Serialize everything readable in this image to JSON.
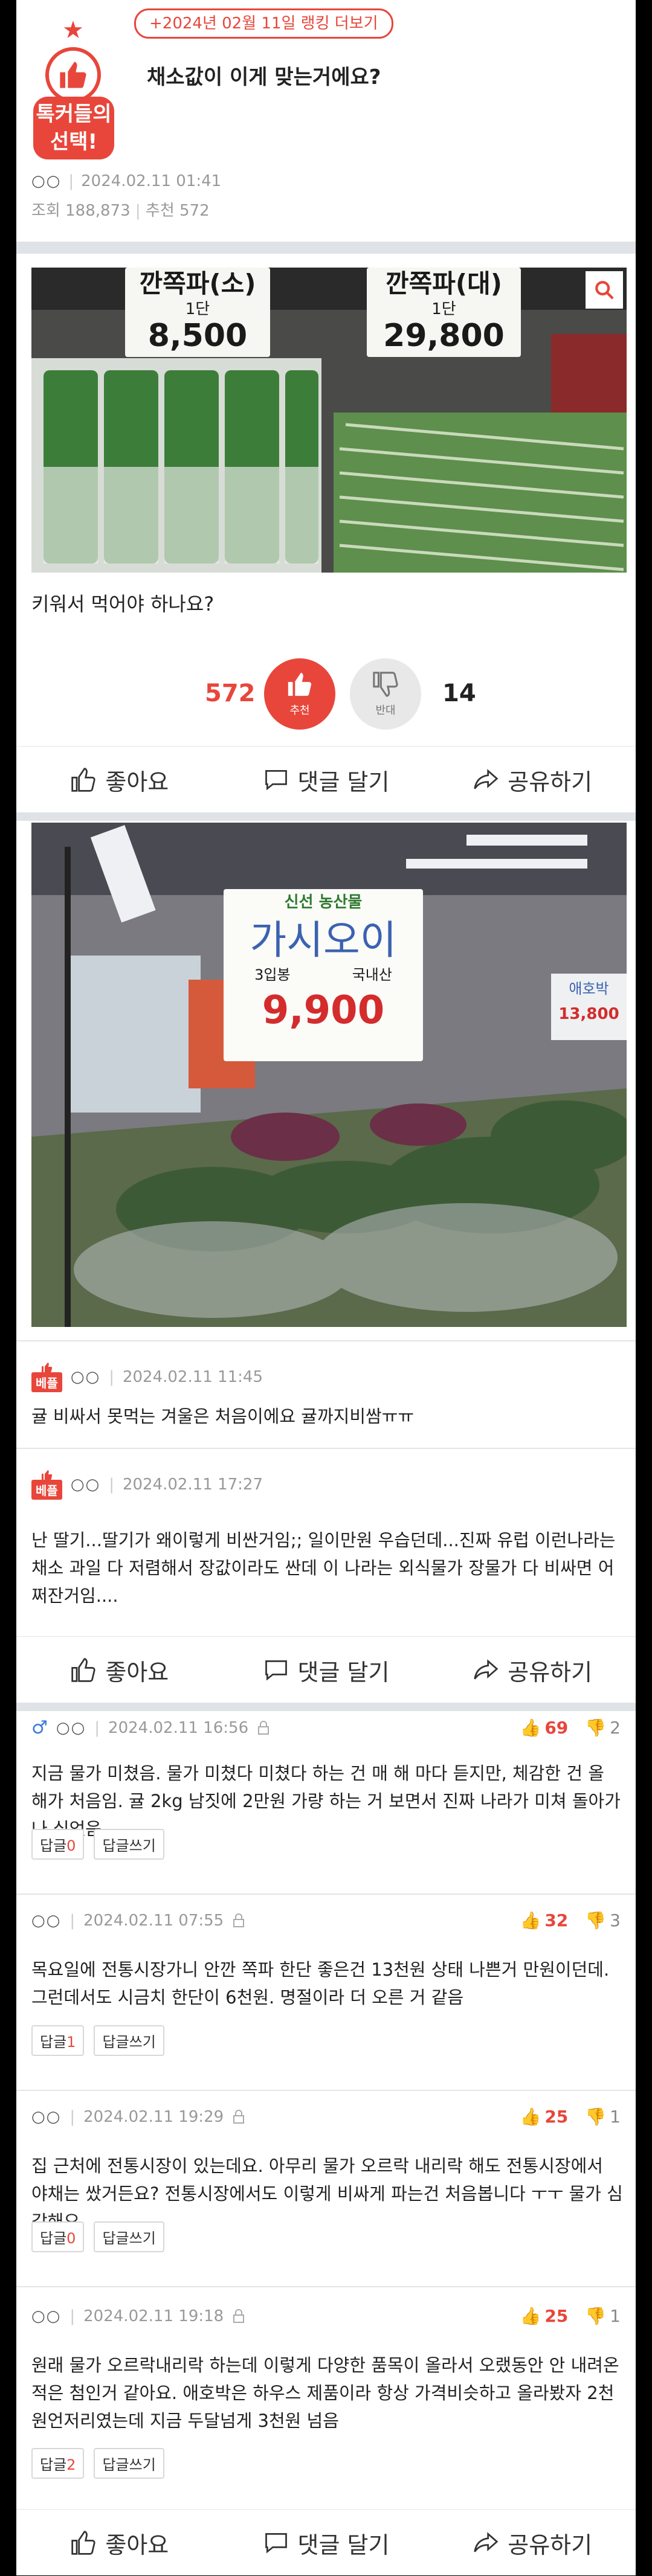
{
  "header": {
    "ranking_link": "+2024년 02월 11일 랭킹 더보기",
    "badge_label": "톡커들의 선택!",
    "title": "채소값이 이게 맞는거에요?",
    "nickname": "○○",
    "date": "2024.02.11 01:41",
    "views": "조회 188,873",
    "recommends": "추천 572"
  },
  "photo1": {
    "sign_small_name": "깐쪽파(소)",
    "sign_small_unit": "1단",
    "sign_small_price": "8,500",
    "sign_large_name": "깐쪽파(대)",
    "sign_large_unit": "1단",
    "sign_large_price": "29,800",
    "zoom_icon": "search-icon"
  },
  "post_body": "키워서 먹어야 하나요?",
  "vote": {
    "recommend_count": "572",
    "recommend_label": "추천",
    "oppose_label": "반대",
    "oppose_count": "14"
  },
  "actions": {
    "like": "좋아요",
    "comment": "댓글 달기",
    "share": "공유하기"
  },
  "photo2": {
    "store_label": "신선 농산물",
    "name": "가시오이",
    "unit": "3입봉",
    "origin": "국내산",
    "price": "9,900",
    "side_sign_name": "애호박",
    "side_sign_price": "13,800"
  },
  "best_comments": [
    {
      "badge": "베플",
      "nickname": "○○",
      "date": "2024.02.11 11:45",
      "text": "귤 비싸서 못먹는 겨울은 처음이에요 귤까지비쌈ㅠㅠ"
    },
    {
      "badge": "베플",
      "nickname": "○○",
      "date": "2024.02.11 17:27",
      "text": "난 딸기...딸기가 왜이렇게 비싼거임;; 일이만원 우습던데...진짜 유럽 이런나라는 채소 과일 다 저렴해서 장값이라도 싼데 이 나라는 외식물가 장물가 다 비싸면 어쩌잔거임...."
    }
  ],
  "replies": [
    {
      "gender_icon": "♂",
      "nickname": "○○",
      "date": "2024.02.11 16:56",
      "up": "69",
      "down": "2",
      "text": "지금 물가 미쳤음. 물가 미쳤다 미쳤다 하는 건 매 해 마다 듣지만, 체감한 건 올 해가 처음임. 귤 2kg 남짓에 2만원 가량 하는 거 보면서 진짜 나라가 미쳐 돌아가나 싶었음.",
      "reply_label": "답글",
      "reply_count": "0",
      "write_label": "답글쓰기"
    },
    {
      "gender_icon": "",
      "nickname": "○○",
      "date": "2024.02.11 07:55",
      "up": "32",
      "down": "3",
      "text": "목요일에 전통시장가니 안깐 쪽파 한단 좋은건 13천원 상태 나쁜거 만원이던데. 그런데서도 시금치 한단이 6천원. 명절이라 더 오른 거 같음",
      "reply_label": "답글",
      "reply_count": "1",
      "write_label": "답글쓰기"
    },
    {
      "gender_icon": "",
      "nickname": "○○",
      "date": "2024.02.11 19:29",
      "up": "25",
      "down": "1",
      "text": "집 근처에 전통시장이 있는데요. 아무리 물가 오르락 내리락 해도 전통시장에서 야채는 쌌거든요? 전통시장에서도 이렇게 비싸게 파는건 처음봅니다 ㅜㅜ 물가 심각해요.",
      "reply_label": "답글",
      "reply_count": "0",
      "write_label": "답글쓰기"
    },
    {
      "gender_icon": "",
      "nickname": "○○",
      "date": "2024.02.11 19:18",
      "up": "25",
      "down": "1",
      "text": "원래 물가 오르락내리락 하는데 이렇게 다양한 품목이 올라서 오랬동안 안 내려온적은 첨인거 같아요. 애호박은 하우스 제품이라 항상 가격비슷하고 올라봤자 2천원언저리였는데 지금 두달넘게 3천원 넘음",
      "reply_label": "답글",
      "reply_count": "2",
      "write_label": "답글쓰기"
    }
  ],
  "colors": {
    "accent": "#e8463b",
    "background": "#eceef1"
  }
}
